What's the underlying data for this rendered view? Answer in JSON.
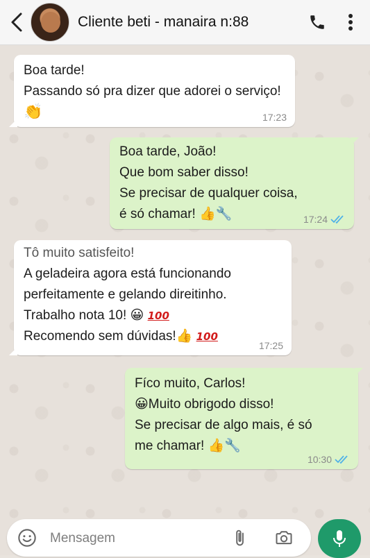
{
  "header": {
    "contact_name": "Cliente beti - manaira n:88",
    "icons": [
      "back-arrow-icon",
      "avatar",
      "phone-icon",
      "more-vertical-icon"
    ]
  },
  "messages": [
    {
      "direction": "incoming",
      "lines": [
        "Boa tarde!",
        "Passando só pra dizer que adorei o serviço!"
      ],
      "emoji_line": "👏",
      "time": "17:23"
    },
    {
      "direction": "outgoing",
      "lines": [
        "Boa tarde, João!",
        "Que bom saber disso!",
        "Se precisar de qualquer coisa,",
        "é só chamar! 👍🔧"
      ],
      "time": "17:24",
      "status": "read"
    },
    {
      "direction": "incoming",
      "lines": [
        "Tô muito satisfeito!",
        "A geladeira agora está funcionando",
        "perfeitamente e gelando direitinho.",
        "Trabalho nota 10! 😀",
        "Recomendo sem dúvidas!👍"
      ],
      "hundred_symbol": "100",
      "time": "17:25"
    },
    {
      "direction": "outgoing",
      "lines": [
        "Fíco muito, Carlos!",
        "😀Muito obrigodo disso!",
        "Se precisar de algo mais, é só",
        "me chamar! 👍🔧"
      ],
      "time": "10:30",
      "status": "read"
    }
  ],
  "composer": {
    "placeholder": "Mensagem"
  },
  "colors": {
    "incoming_bubble": "#ffffff",
    "outgoing_bubble": "#dcf3c9",
    "mic_button": "#1f9a6a",
    "read_ticks": "#4fb1e8"
  }
}
